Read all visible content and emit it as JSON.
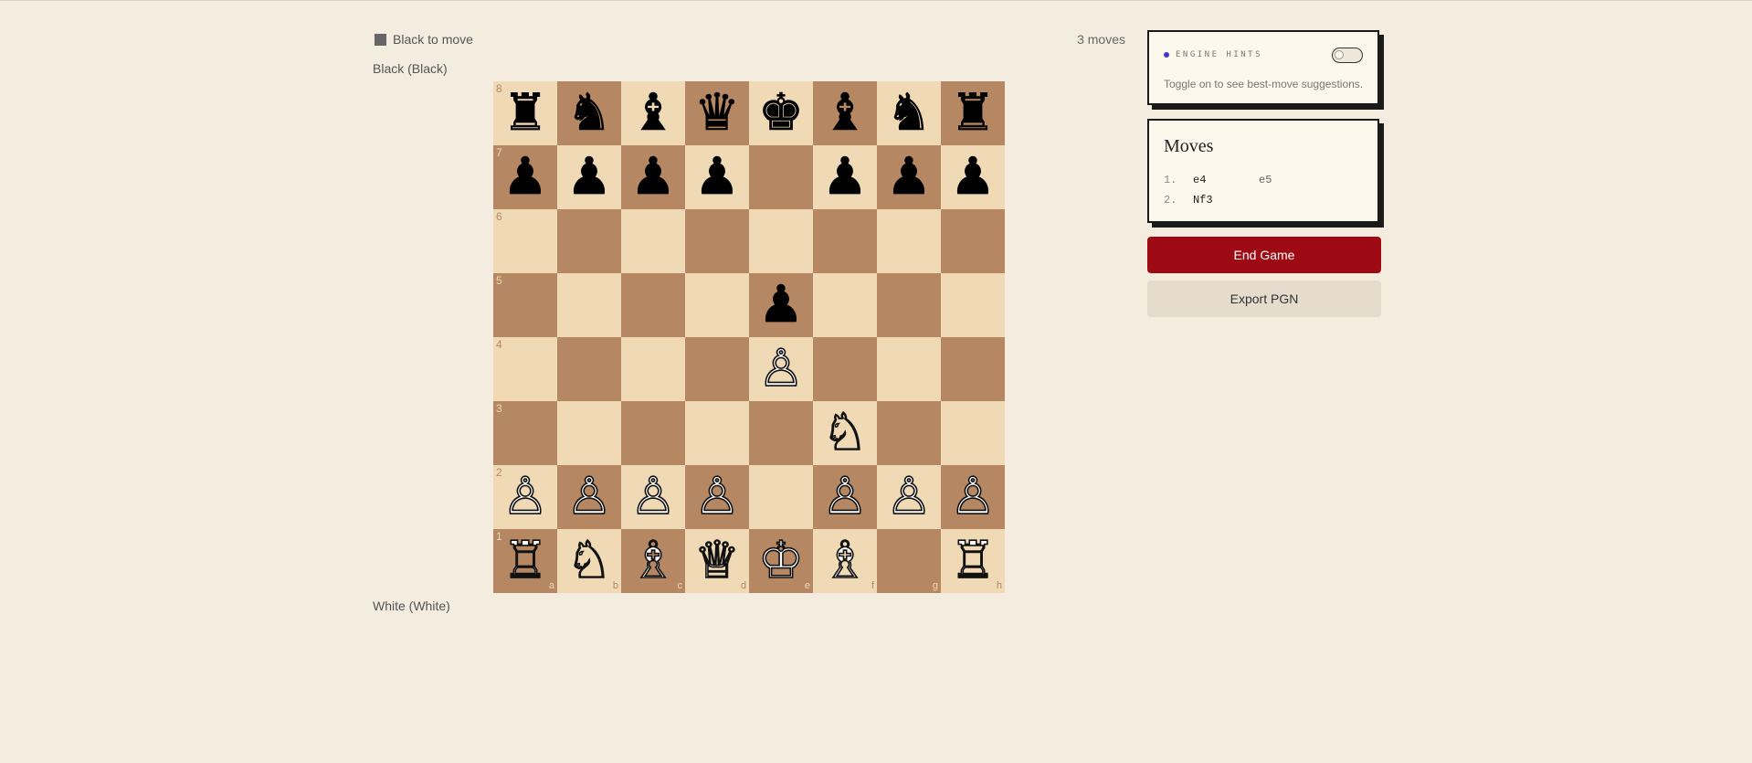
{
  "status": {
    "turn_text": "Black to move",
    "move_count": "3 moves"
  },
  "players": {
    "top": "Black (Black)",
    "bottom": "White (White)"
  },
  "board": {
    "orientation": "white-bottom",
    "ranks_top_to_bottom": [
      [
        "♜",
        "♞",
        "♝",
        "♛",
        "♚",
        "♝",
        "♞",
        "♜"
      ],
      [
        "♟",
        "♟",
        "♟",
        "♟",
        "",
        "♟",
        "♟",
        "♟"
      ],
      [
        "",
        "",
        "",
        "",
        "",
        "",
        "",
        ""
      ],
      [
        "",
        "",
        "",
        "",
        "♟",
        "",
        "",
        ""
      ],
      [
        "",
        "",
        "",
        "",
        "♙",
        "",
        "",
        ""
      ],
      [
        "",
        "",
        "",
        "",
        "",
        "♘",
        "",
        ""
      ],
      [
        "♙",
        "♙",
        "♙",
        "♙",
        "",
        "♙",
        "♙",
        "♙"
      ],
      [
        "♖",
        "♘",
        "♗",
        "♕",
        "♔",
        "♗",
        "",
        "♖"
      ]
    ],
    "rank_labels": [
      "8",
      "7",
      "6",
      "5",
      "4",
      "3",
      "2",
      "1"
    ],
    "file_labels": [
      "a",
      "b",
      "c",
      "d",
      "e",
      "f",
      "g",
      "h"
    ],
    "colors": {
      "light": "#f0d9b5",
      "dark": "#b58863"
    }
  },
  "engine_hints": {
    "title": "ENGINE HINTS",
    "description": "Toggle on to see best-move suggestions.",
    "enabled": false,
    "dot_color": "#3b3bd0"
  },
  "moves_panel": {
    "title": "Moves",
    "rows": [
      {
        "num": "1.",
        "white": "e4",
        "black": "e5"
      },
      {
        "num": "2.",
        "white": "Nf3",
        "black": ""
      }
    ]
  },
  "buttons": {
    "end_game": "End Game",
    "export_pgn": "Export PGN"
  },
  "theme": {
    "background": "#f3ecdf",
    "accent_red": "#9e0a14"
  }
}
